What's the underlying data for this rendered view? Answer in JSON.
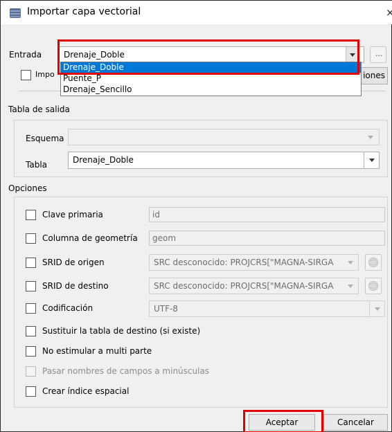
{
  "window": {
    "title": "Importar capa vectorial",
    "close": "×"
  },
  "entrada": {
    "label": "Entrada",
    "value": "Drenaje_Doble",
    "browse": "...",
    "options": [
      "Drenaje_Doble",
      "Puente_P",
      "Drenaje_Sencillo"
    ]
  },
  "hidden_row": {
    "import_label_partial": "Impo",
    "button_partial": "iones"
  },
  "output": {
    "section_title": "Tabla de salida",
    "schema_label": "Esquema",
    "schema_value": "",
    "table_label": "Tabla",
    "table_value": "Drenaje_Doble"
  },
  "options": {
    "section_title": "Opciones",
    "primary_key": {
      "label": "Clave primaria",
      "value": "id"
    },
    "geom_column": {
      "label": "Columna de geometría",
      "value": "geom"
    },
    "srid_source": {
      "label": "SRID de origen",
      "value": "SRC desconocido: PROJCRS[\"MAGNA-SIRGA"
    },
    "srid_dest": {
      "label": "SRID de destino",
      "value": "SRC desconocido: PROJCRS[\"MAGNA-SIRGA"
    },
    "encoding": {
      "label": "Codificación",
      "value": "UTF-8"
    },
    "replace_table": "Sustituir la tabla de destino (si existe)",
    "no_multipart": "No estimular a multi parte",
    "lowercase": "Pasar nombres de campos a minúsculas",
    "spatial_index": "Crear índice espacial"
  },
  "buttons": {
    "accept": "Aceptar",
    "cancel": "Cancelar"
  },
  "colors": {
    "highlight": "#e00000",
    "selection": "#0078d7"
  }
}
